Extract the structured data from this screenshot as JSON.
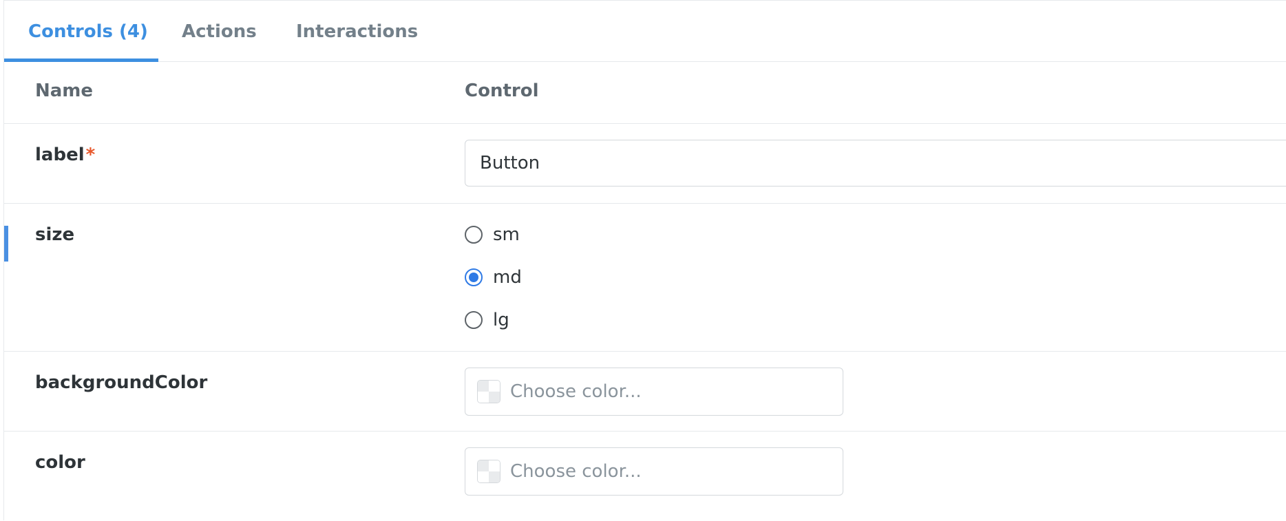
{
  "tabs": [
    {
      "label": "Controls (4)",
      "active": true
    },
    {
      "label": "Actions",
      "active": false
    },
    {
      "label": "Interactions",
      "active": false
    }
  ],
  "table": {
    "headers": {
      "name": "Name",
      "control": "Control"
    },
    "rows": {
      "label": {
        "name": "label",
        "required_mark": "*",
        "value": "Button"
      },
      "size": {
        "name": "size",
        "options": [
          {
            "label": "sm",
            "checked": false
          },
          {
            "label": "md",
            "checked": true
          },
          {
            "label": "lg",
            "checked": false
          }
        ]
      },
      "backgroundColor": {
        "name": "backgroundColor",
        "placeholder": "Choose color..."
      },
      "color": {
        "name": "color",
        "placeholder": "Choose color..."
      }
    }
  },
  "colors": {
    "accent": "#3d8fe0",
    "radio_checked": "#2f7ae5",
    "required": "#e8582c",
    "border": "#e6e9ec"
  }
}
